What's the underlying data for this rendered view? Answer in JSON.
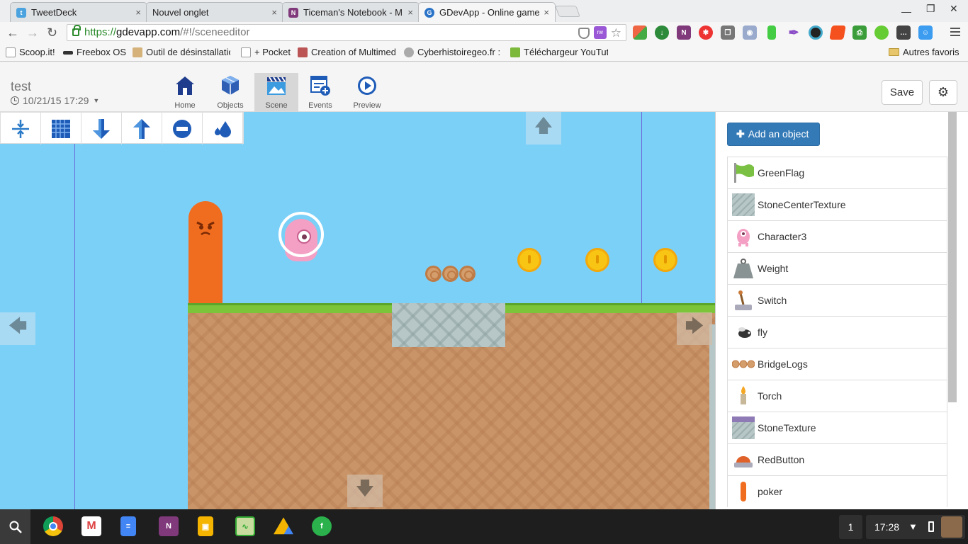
{
  "browser": {
    "tabs": [
      {
        "label": "TweetDeck",
        "close": "×"
      },
      {
        "label": "Nouvel onglet",
        "close": "×"
      },
      {
        "label": "Ticeman's Notebook - M",
        "close": "×"
      },
      {
        "label": "GDevApp - Online game",
        "close": "×"
      }
    ],
    "url": {
      "scheme": "https://",
      "host": "gdevapp.com",
      "path": "/#!/sceneeditor"
    },
    "bookmarks": [
      "Scoop.it!",
      "Freebox OS",
      "Outil de désinstallatio",
      "+ Pocket",
      "Creation of Multimed",
      "Cyberhistoiregeo.fr :",
      "Téléchargeur YouTut"
    ],
    "other_bookmarks": "Autres favoris"
  },
  "project": {
    "name": "test",
    "date": "10/21/15 17:29"
  },
  "nav": [
    {
      "label": "Home"
    },
    {
      "label": "Objects"
    },
    {
      "label": "Scene"
    },
    {
      "label": "Events"
    },
    {
      "label": "Preview"
    }
  ],
  "actions": {
    "save": "Save"
  },
  "panel": {
    "add_object": "Add an object"
  },
  "objects": [
    {
      "name": "GreenFlag",
      "icon": "green-flag-icon"
    },
    {
      "name": "StoneCenterTexture",
      "icon": "stone-center-texture-icon"
    },
    {
      "name": "Character3",
      "icon": "character3-icon"
    },
    {
      "name": "Weight",
      "icon": "weight-icon"
    },
    {
      "name": "Switch",
      "icon": "switch-icon"
    },
    {
      "name": "fly",
      "icon": "fly-icon"
    },
    {
      "name": "BridgeLogs",
      "icon": "bridge-logs-icon"
    },
    {
      "name": "Torch",
      "icon": "torch-icon"
    },
    {
      "name": "StoneTexture",
      "icon": "stone-texture-icon"
    },
    {
      "name": "RedButton",
      "icon": "red-button-icon"
    },
    {
      "name": "poker",
      "icon": "poker-icon"
    }
  ],
  "shelf": {
    "notifications": "1",
    "time": "17:28"
  },
  "colors": {
    "scene_bg": "#7bd0f8",
    "accent": "#337ab7",
    "active_tab": "#d7d7d7"
  }
}
